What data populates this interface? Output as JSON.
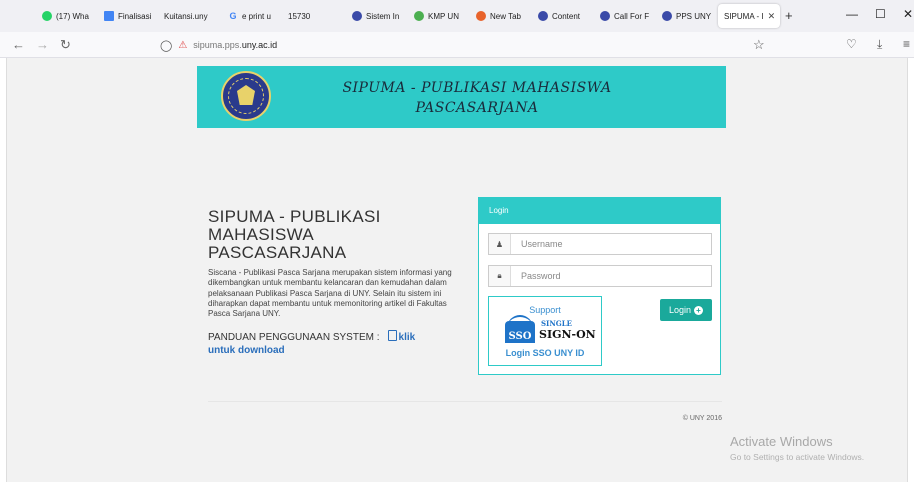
{
  "browser": {
    "tabs": [
      {
        "label": "(17) Wha",
        "icon": "whatsapp-icon",
        "color": "#25d366",
        "glyph": ""
      },
      {
        "label": "Finalisasi",
        "icon": "google-docs-icon",
        "color": "#4285f4",
        "glyph": ""
      },
      {
        "label": "Kuitansi.uny",
        "icon": "",
        "color": "",
        "glyph": ""
      },
      {
        "label": "e print u",
        "icon": "google-icon",
        "color": "",
        "glyph": "G"
      },
      {
        "label": "15730",
        "icon": "",
        "color": "",
        "glyph": ""
      },
      {
        "label": "Sistem In",
        "icon": "uny-icon",
        "color": "#3a4aa8",
        "glyph": ""
      },
      {
        "label": "KMP UN",
        "icon": "globe-icon",
        "color": "#4caf50",
        "glyph": ""
      },
      {
        "label": "New Tab",
        "icon": "firefox-icon",
        "color": "#e8632b",
        "glyph": ""
      },
      {
        "label": "Content",
        "icon": "uny-icon",
        "color": "#3a4aa8",
        "glyph": ""
      },
      {
        "label": "Call For F",
        "icon": "uny-icon",
        "color": "#3a4aa8",
        "glyph": ""
      },
      {
        "label": "PPS UNY",
        "icon": "uny-icon",
        "color": "#3a4aa8",
        "glyph": ""
      },
      {
        "label": "SIPUMA - I",
        "icon": "",
        "color": "",
        "glyph": "",
        "active": true
      }
    ],
    "url": {
      "host_prefix": "sipuma.pps.",
      "host_domain": "uny.ac.id"
    }
  },
  "banner": {
    "line1": "SIPUMA - PUBLIKASI MAHASISWA",
    "line2": "PASCASARJANA"
  },
  "info": {
    "heading_line1": "SIPUMA - PUBLIKASI",
    "heading_line2": "MAHASISWA",
    "heading_line3": "PASCASARJANA",
    "description": "Siscana - Publikasi Pasca Sarjana merupakan sistem informasi yang dikembangkan untuk membantu kelancaran dan kemudahan dalam pelaksanaan Publikasi Pasca Sarjana di UNY. Selain itu sistem ini diharapkan dapat membantu untuk memonitoring artikel di Fakultas Pasca Sarjana UNY.",
    "guide_label": "PANDUAN PENGGUNAAN SYSTEM :",
    "guide_link_1": "klik",
    "guide_link_2": "untuk download"
  },
  "login": {
    "header": "Login",
    "username_placeholder": "Username",
    "password_placeholder": "Password",
    "button": "Login",
    "sso_support": "Support",
    "sso_badge": "SSO",
    "sso_single": "SINGLE",
    "sso_signon": "SIGN-ON",
    "sso_link": "Login SSO UNY ID"
  },
  "footer": {
    "copyright": "© UNY 2016"
  },
  "watermark": {
    "title": "Activate Windows",
    "subtitle": "Go to Settings to activate Windows."
  },
  "colors": {
    "accent": "#2ecac8",
    "button": "#1aa99b",
    "link": "#2a6ebb"
  }
}
